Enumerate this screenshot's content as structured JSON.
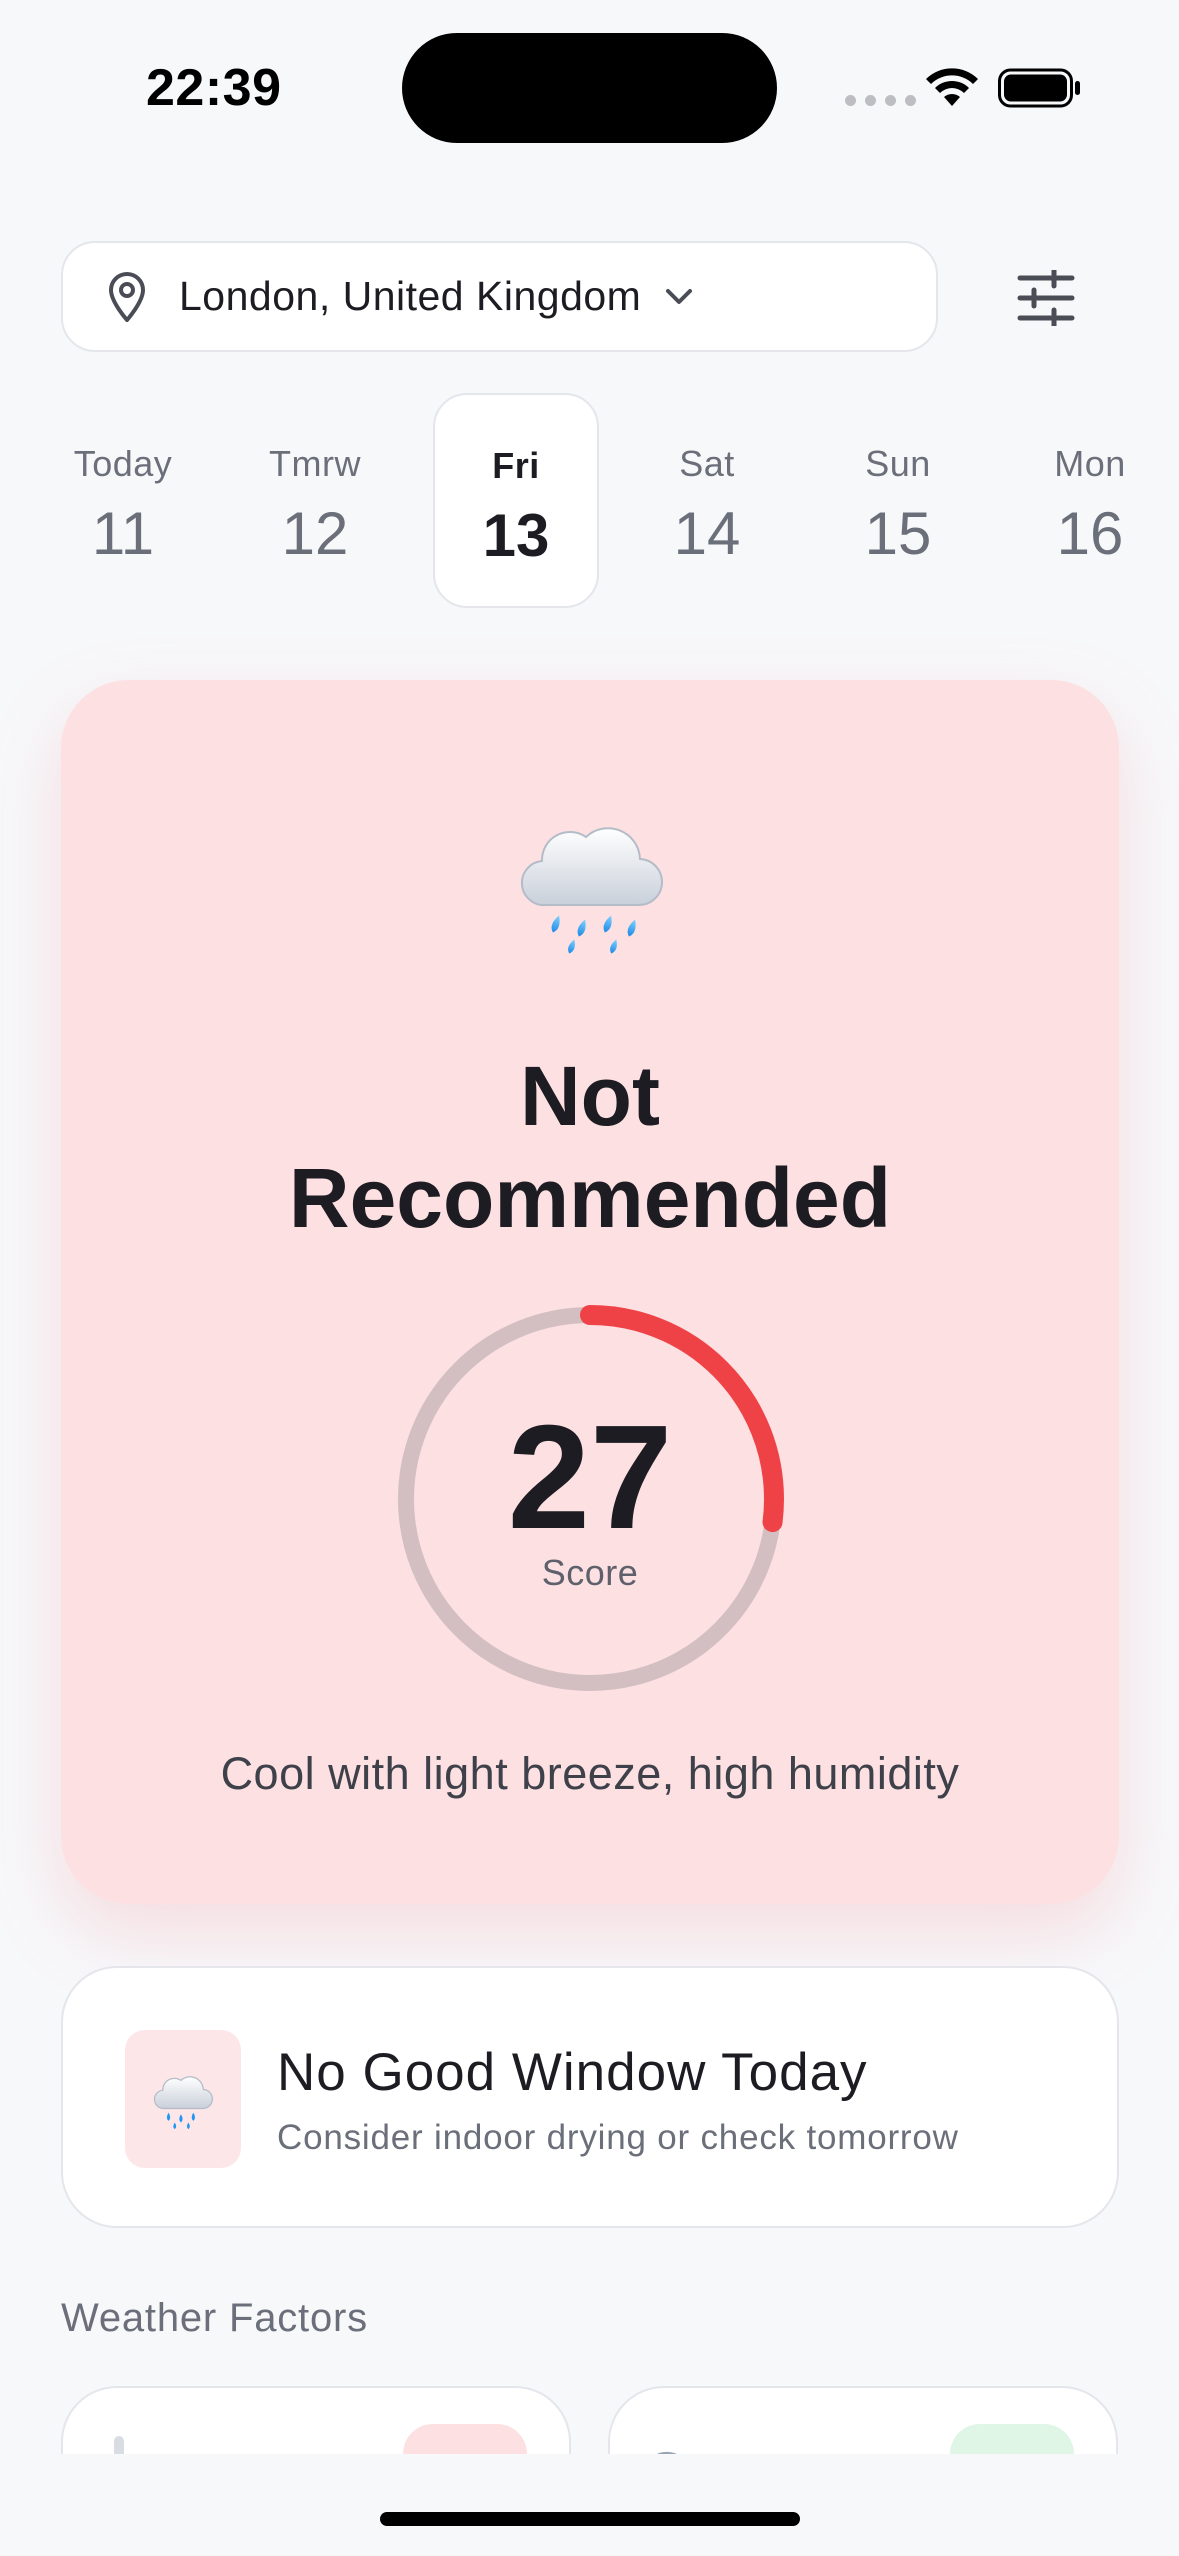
{
  "status_bar": {
    "time": "22:39"
  },
  "location": {
    "label": "London, United Kingdom"
  },
  "dates": [
    {
      "dow": "Today",
      "day": "11",
      "selected": false
    },
    {
      "dow": "Tmrw",
      "day": "12",
      "selected": false
    },
    {
      "dow": "Fri",
      "day": "13",
      "selected": true
    },
    {
      "dow": "Sat",
      "day": "14",
      "selected": false
    },
    {
      "dow": "Sun",
      "day": "15",
      "selected": false
    },
    {
      "dow": "Mon",
      "day": "16",
      "selected": false
    }
  ],
  "main_card": {
    "icon": "rain-cloud-icon",
    "verdict_line1": "Not",
    "verdict_line2": "Recommended",
    "score": "27",
    "score_fraction": 0.27,
    "score_label": "Score",
    "summary": "Cool with light breeze, high humidity"
  },
  "window_card": {
    "icon": "rain-cloud-icon",
    "title": "No Good Window Today",
    "subtitle": "Consider indoor drying or check tomorrow"
  },
  "weather_factors": {
    "title": "Weather Factors",
    "cards": [
      {
        "icon": "thermometer-icon",
        "badge_color": "#FDE0E2"
      },
      {
        "icon": "wind-icon",
        "badge_color": "#DFF5E6"
      }
    ]
  },
  "colors": {
    "background": "#F7F8FA",
    "card_bad": "#FDE0E2",
    "gauge_track": "#D3BFC1",
    "gauge_fill": "#EF4247",
    "text_primary": "#1C1C22",
    "text_secondary": "#6B6F7A"
  }
}
